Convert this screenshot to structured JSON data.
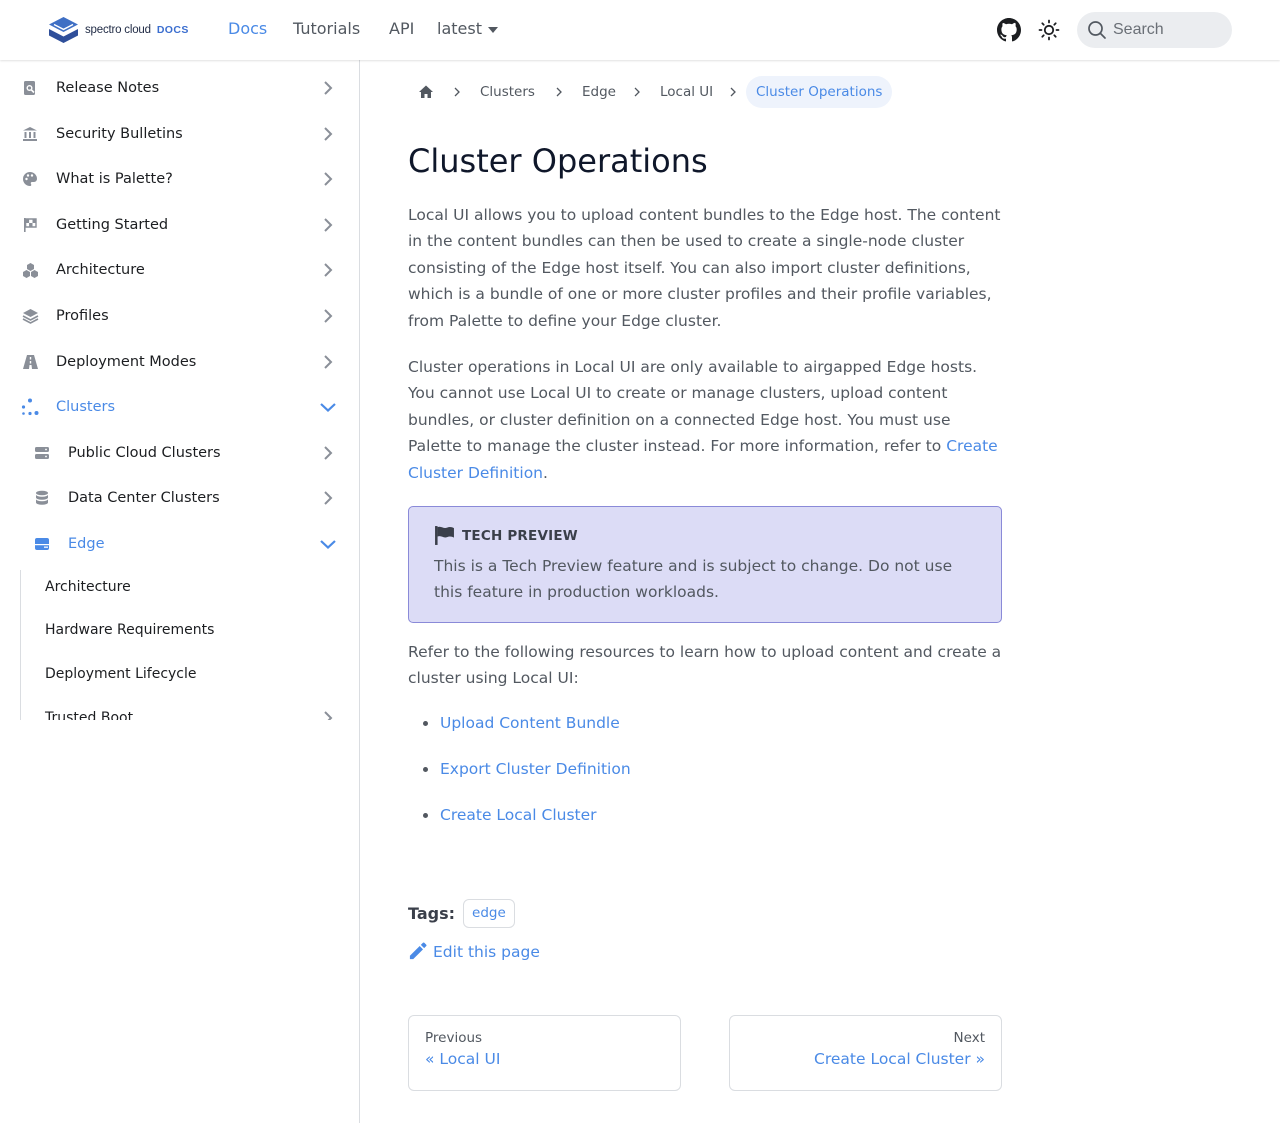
{
  "navbar": {
    "logo_text": "spectro cloud",
    "logo_docs": "DOCS",
    "links": [
      "Docs",
      "Tutorials",
      "API"
    ],
    "version": "latest",
    "search_placeholder": "Search",
    "github_icon": "github-icon",
    "theme_icon": "sun-icon"
  },
  "sidebar": {
    "items": [
      {
        "label": "Release Notes",
        "icon": "release-notes-icon"
      },
      {
        "label": "Security Bulletins",
        "icon": "bank-icon"
      },
      {
        "label": "What is Palette?",
        "icon": "palette-icon"
      },
      {
        "label": "Getting Started",
        "icon": "flag-checkered-icon"
      },
      {
        "label": "Architecture",
        "icon": "cubes-icon"
      },
      {
        "label": "Profiles",
        "icon": "layer-group-icon"
      },
      {
        "label": "Deployment Modes",
        "icon": "road-icon"
      },
      {
        "label": "Clusters",
        "icon": "cluster-icon"
      }
    ],
    "cluster_children": [
      {
        "label": "Public Cloud Clusters",
        "icon": "server-icon"
      },
      {
        "label": "Data Center Clusters",
        "icon": "database-icon"
      },
      {
        "label": "Edge",
        "icon": "edge-hdd-icon"
      }
    ],
    "edge_children": [
      "Architecture",
      "Hardware Requirements",
      "Deployment Lifecycle",
      "Trusted Boot"
    ]
  },
  "breadcrumb": {
    "items": [
      "Clusters",
      "Edge",
      "Local UI"
    ],
    "current": "Cluster Operations"
  },
  "page": {
    "title": "Cluster Operations",
    "para1": "Local UI allows you to upload content bundles to the Edge host. The content in the content bundles can then be used to create a single-node cluster consisting of the Edge host itself. You can also import cluster definitions, which is a bundle of one or more cluster profiles and their profile variables, from Palette to define your Edge cluster.",
    "para2": "Cluster operations in Local UI are only available to airgapped Edge hosts. You cannot use Local UI to create or manage clusters, upload content bundles, or cluster definition on a connected Edge host. You must use Palette to manage the cluster instead. For more information, refer to ",
    "para2_link": "Create Cluster Definition",
    "para2_end": ".",
    "admonition_title": "TECH PREVIEW",
    "admonition_body": "This is a Tech Preview feature and is subject to change. Do not use this feature in production workloads.",
    "para3": "Refer to the following resources to learn how to upload content and create a cluster using Local UI:",
    "resources": [
      "Upload Content Bundle",
      "Export Cluster Definition",
      "Create Local Cluster"
    ],
    "tags_label": "Tags:",
    "tags": [
      "edge"
    ],
    "edit_label": "Edit this page",
    "prev_sub": "Previous",
    "prev_label": "« Local UI",
    "next_sub": "Next",
    "next_label": "Create Local Cluster »"
  },
  "colors": {
    "accent": "#4a8ae6",
    "text": "#525860",
    "admonition_bg": "#dcdcf6",
    "admonition_border": "#8a8ad8"
  }
}
